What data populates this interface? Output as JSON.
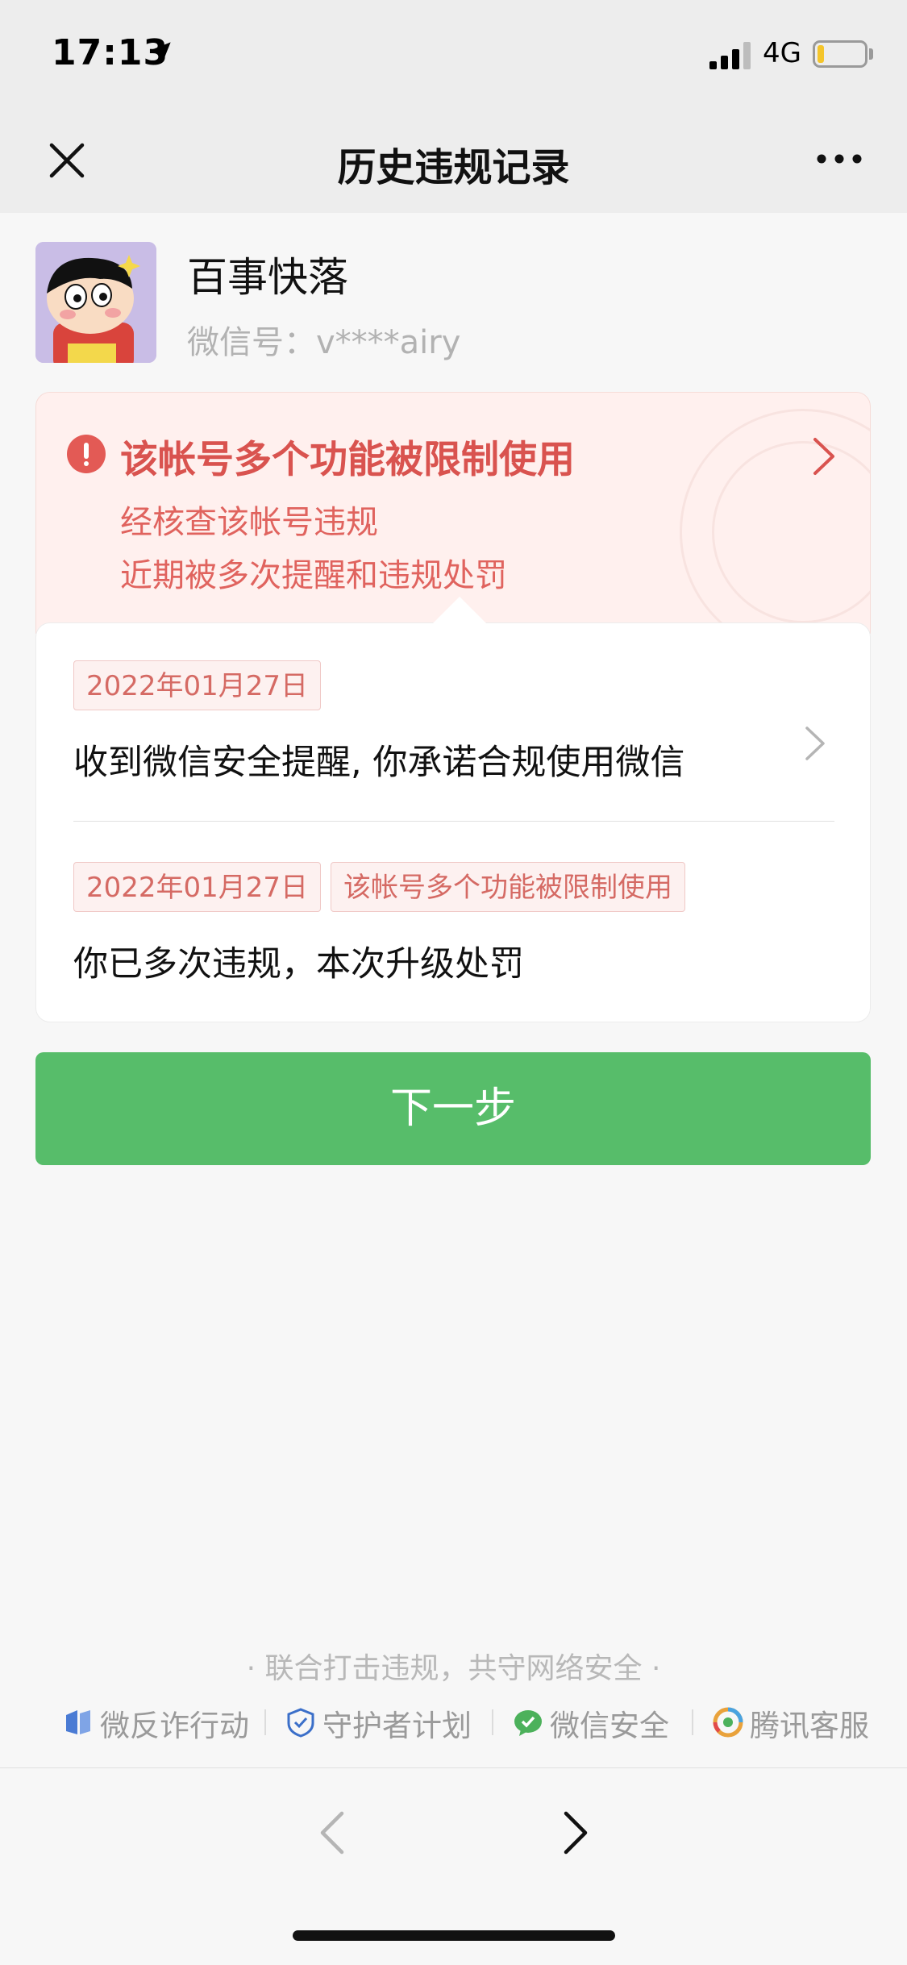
{
  "status_bar": {
    "time": "17:13",
    "network": "4G"
  },
  "navbar": {
    "title": "历史违规记录"
  },
  "profile": {
    "nickname": "百事快落",
    "wechat_id": "微信号：v****airy"
  },
  "notice": {
    "title": "该帐号多个功能被限制使用",
    "lines": [
      "经核查该帐号违规",
      "近期被多次提醒和违规处罚"
    ]
  },
  "records": [
    {
      "tags": [
        "2022年01月27日"
      ],
      "text": "收到微信安全提醒, 你承诺合规使用微信"
    },
    {
      "tags": [
        "2022年01月27日",
        "该帐号多个功能被限制使用"
      ],
      "text": "你已多次违规，本次升级处罚"
    }
  ],
  "next_button": {
    "label": "下一步"
  },
  "footer": {
    "slogan": "· 联合打击违规，共守网络安全 ·",
    "links": [
      "微反诈行动",
      "守护者计划",
      "微信安全",
      "腾讯客服"
    ]
  },
  "colors": {
    "accent_green": "#57bd6a",
    "alert_red": "#d9534f",
    "notice_bg": "#fff0ee"
  }
}
